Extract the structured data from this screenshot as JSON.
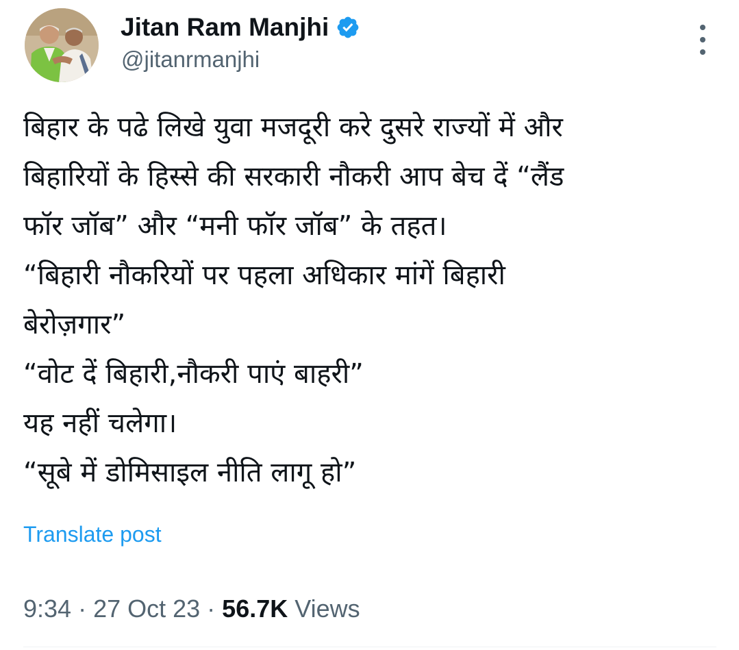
{
  "author": {
    "display_name": "Jitan Ram Manjhi",
    "handle": "@jitanrmanjhi",
    "verified_icon": "verified-badge-icon",
    "verified_color": "#1d9bf0"
  },
  "tweet": {
    "lines": [
      "बिहार के पढे लिखे युवा मजदूरी करे दुसरे राज्यों में और",
      "बिहारियों के हिस्से की सरकारी नौकरी आप बेच दें “लैंड",
      "फॉर जॉब” और “मनी फॉर जॉब” के तहत।",
      "“बिहारी नौकरियों पर पहला अधिकार मांगें बिहारी",
      "बेरोज़गार”",
      "“वोट दें बिहारी,नौकरी पाएं बाहरी”",
      "यह नहीं चलेगा।",
      "“सूबे में डोमिसाइल नीति लागू हो”"
    ],
    "translate_label": "Translate post"
  },
  "meta": {
    "time": "9:34",
    "separator": " · ",
    "date": "27 Oct 23",
    "views_count": "56.7K",
    "views_label": "Views"
  },
  "colors": {
    "text": "#0f1419",
    "secondary": "#536471",
    "accent": "#1d9bf0"
  },
  "icons": {
    "more": "more-options-icon"
  }
}
